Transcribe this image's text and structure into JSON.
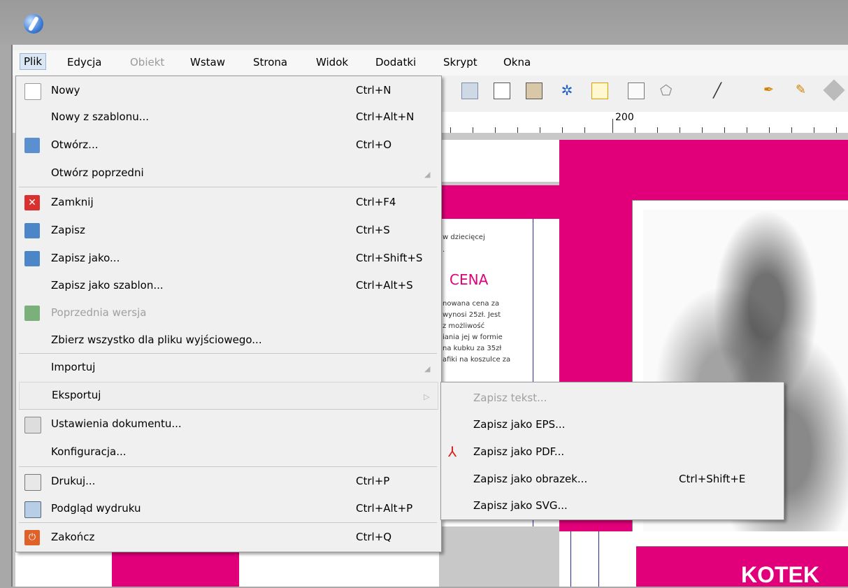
{
  "menubar": {
    "items": [
      {
        "label": "Plik",
        "state": "active"
      },
      {
        "label": "Edycja",
        "state": "normal"
      },
      {
        "label": "Obiekt",
        "state": "disabled"
      },
      {
        "label": "Wstaw",
        "state": "normal"
      },
      {
        "label": "Strona",
        "state": "normal"
      },
      {
        "label": "Widok",
        "state": "normal"
      },
      {
        "label": "Dodatki",
        "state": "normal"
      },
      {
        "label": "Skrypt",
        "state": "normal"
      },
      {
        "label": "Okna",
        "state": "normal"
      }
    ]
  },
  "file_menu": {
    "items": [
      {
        "label": "Nowy",
        "shortcut": "Ctrl+N",
        "icon": "new-document-icon"
      },
      {
        "label": "Nowy z szablonu...",
        "shortcut": "Ctrl+Alt+N"
      },
      {
        "label": "Otwórz...",
        "shortcut": "Ctrl+O",
        "icon": "open-folder-icon"
      },
      {
        "label": "Otwórz poprzedni",
        "shortcut": "",
        "submenu": true
      },
      {
        "label": "Zamknij",
        "shortcut": "Ctrl+F4",
        "icon": "close-icon"
      },
      {
        "label": "Zapisz",
        "shortcut": "Ctrl+S",
        "icon": "save-icon"
      },
      {
        "label": "Zapisz jako...",
        "shortcut": "Ctrl+Shift+S",
        "icon": "save-as-icon"
      },
      {
        "label": "Zapisz jako szablon...",
        "shortcut": "Ctrl+Alt+S"
      },
      {
        "label": "Poprzednia wersja",
        "shortcut": "",
        "icon": "revert-icon",
        "disabled": true
      },
      {
        "label": "Zbierz wszystko dla pliku wyjściowego...",
        "shortcut": ""
      },
      {
        "label": "Importuj",
        "shortcut": "",
        "submenu": true
      },
      {
        "label": "Eksportuj",
        "shortcut": "",
        "submenu": true,
        "highlighted": true
      },
      {
        "label": "Ustawienia dokumentu...",
        "shortcut": "",
        "icon": "document-settings-icon"
      },
      {
        "label": "Konfiguracja...",
        "shortcut": ""
      },
      {
        "label": "Drukuj...",
        "shortcut": "Ctrl+P",
        "icon": "print-icon"
      },
      {
        "label": "Podgląd wydruku",
        "shortcut": "Ctrl+Alt+P",
        "icon": "print-preview-icon"
      },
      {
        "label": "Zakończ",
        "shortcut": "Ctrl+Q",
        "icon": "exit-icon"
      }
    ]
  },
  "export_submenu": {
    "items": [
      {
        "label": "Zapisz tekst...",
        "shortcut": "",
        "disabled": true
      },
      {
        "label": "Zapisz jako EPS...",
        "shortcut": ""
      },
      {
        "label": "Zapisz jako PDF...",
        "shortcut": "",
        "icon": "pdf-icon"
      },
      {
        "label": "Zapisz jako obrazek...",
        "shortcut": "Ctrl+Shift+E"
      },
      {
        "label": "Zapisz jako SVG...",
        "shortcut": ""
      }
    ]
  },
  "ruler": {
    "label": "200"
  },
  "document": {
    "text_lines": [
      "w dziecięcej",
      ".",
      "nowana cena za",
      "wynosi 25zł. Jest",
      "z możliwość",
      "iania jej w formie",
      "na kubku za 35zł",
      "afiki na koszulce za"
    ],
    "heading": "CENA",
    "banner": "KOTEK"
  },
  "colors": {
    "accent": "#e2007a",
    "highlight": "#dbe6f4"
  }
}
